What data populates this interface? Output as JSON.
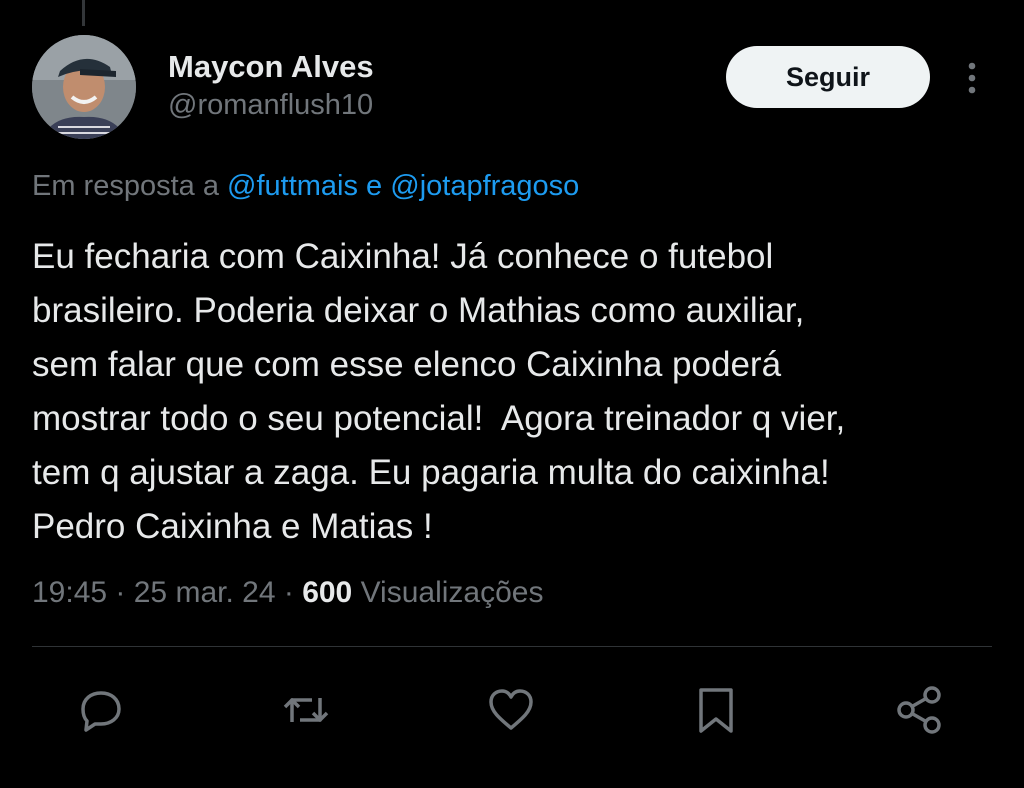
{
  "author": {
    "name": "Maycon Alves",
    "handle": "@romanflush10"
  },
  "follow_button": {
    "label": "Seguir"
  },
  "more_icon": "more-vertical-icon",
  "reply_to": {
    "prefix": "Em resposta a ",
    "mention_1": "@futtmais",
    "joiner": " e ",
    "mention_2": "@jotapfragoso"
  },
  "tweet": {
    "text": "Eu fecharia com Caixinha! Já conhece o futebol\nbrasileiro. Poderia deixar o Mathias como auxiliar,\nsem falar que com esse elenco Caixinha poderá\nmostrar todo o seu potencial!  Agora treinador q vier,\ntem q ajustar a zaga. Eu pagaria multa do caixinha!\nPedro Caixinha e Matias !",
    "time": "19:45",
    "sep": " · ",
    "date": "25 mar. 24",
    "views_count": "600",
    "views_label": " Visualizações"
  },
  "actions": [
    {
      "name": "reply",
      "icon": "reply-icon"
    },
    {
      "name": "retweet",
      "icon": "retweet-icon"
    },
    {
      "name": "like",
      "icon": "heart-icon"
    },
    {
      "name": "bookmark",
      "icon": "bookmark-icon"
    },
    {
      "name": "share",
      "icon": "share-icon"
    }
  ],
  "colors": {
    "background": "#000000",
    "text": "#e7e9ea",
    "muted": "#71767b",
    "link": "#1d9bf0",
    "button_bg": "#eff3f4"
  }
}
